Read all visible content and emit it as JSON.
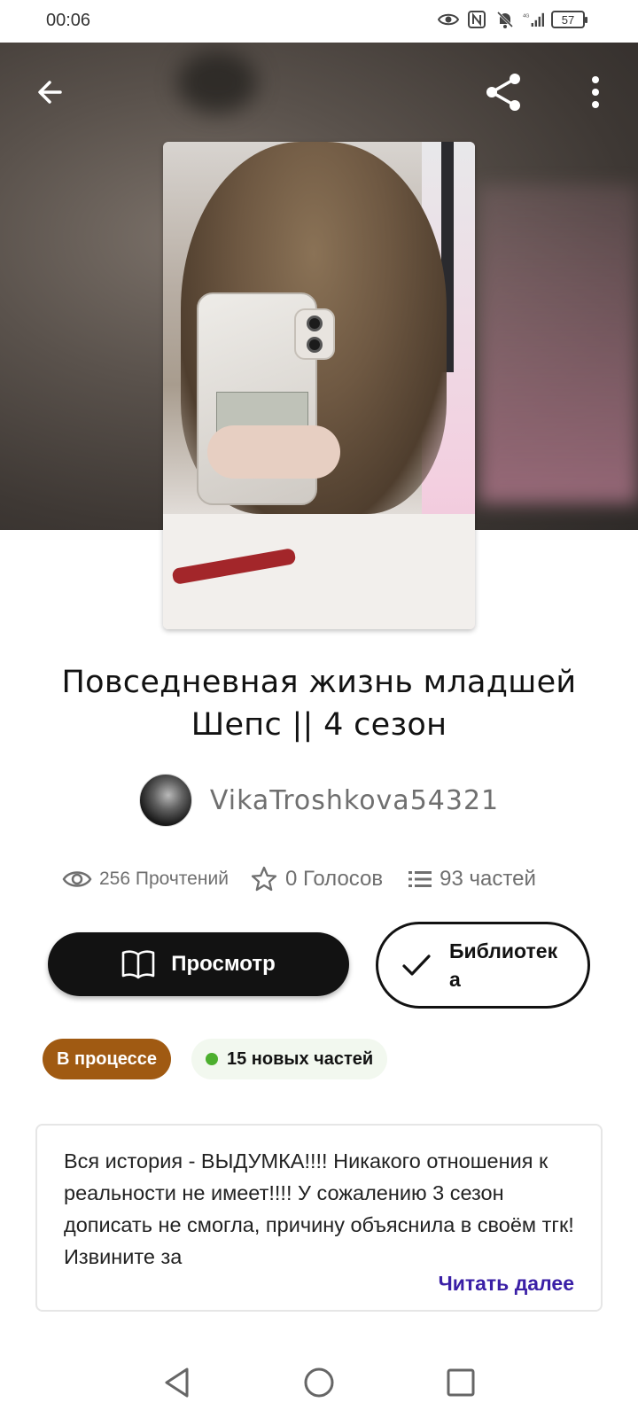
{
  "status_bar": {
    "time": "00:06",
    "battery": "57",
    "network": "4G"
  },
  "header": {
    "back_icon": "arrow-left-icon",
    "share_icon": "share-icon",
    "more_icon": "more-vertical-icon"
  },
  "story": {
    "title": "Повседневная жизнь младшей Шепс || 4 сезон",
    "author": "VikaTroshkova54321",
    "stats": {
      "reads": "256 Прочтений",
      "votes": "0 Голосов",
      "parts": "93 частей"
    },
    "buttons": {
      "view": "Просмотр",
      "library": "Библиотека"
    },
    "badges": {
      "status": "В процессе",
      "new_parts": "15 новых частей"
    },
    "description": "Вся история - ВЫДУМКА!!!! Никакого отношения к реальности не имеет!!!! У сожалению 3 сезон дописать не смогла, причину объяснила в своём тгк! Извините за",
    "read_more": "Читать далее"
  },
  "colors": {
    "primary": "#121212",
    "status_badge": "#a05a12",
    "new_parts_dot": "#4caf2e",
    "link": "#3a1fa6"
  }
}
